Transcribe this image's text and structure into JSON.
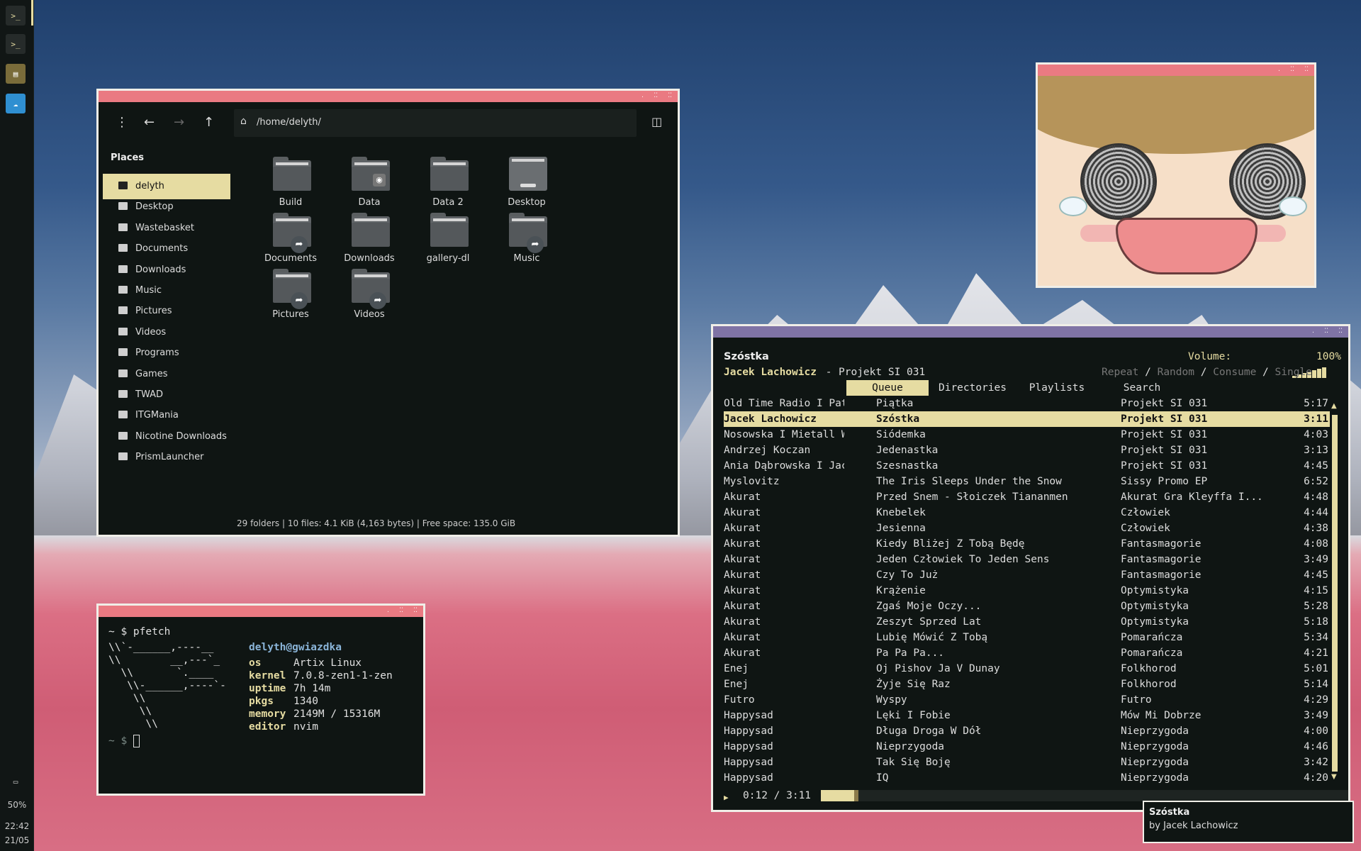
{
  "panel": {
    "launchers": [
      "terminal-icon",
      "terminal-icon",
      "file-manager-icon",
      "image-viewer-icon"
    ],
    "volume": "50%",
    "time": "22:42",
    "date": "21/05"
  },
  "file_manager": {
    "path": "/home/delyth/",
    "places_title": "Places",
    "places": [
      "delyth",
      "Desktop",
      "Wastebasket",
      "Documents",
      "Downloads",
      "Music",
      "Pictures",
      "Videos",
      "Programs",
      "Games",
      "TWAD",
      "ITGMania",
      "Nicotine Downloads",
      "PrismLauncher"
    ],
    "selected_place": "delyth",
    "items": [
      {
        "name": "Build",
        "badge": ""
      },
      {
        "name": "Data",
        "badge": "disk"
      },
      {
        "name": "Data 2",
        "badge": ""
      },
      {
        "name": "Desktop",
        "badge": "desktop"
      },
      {
        "name": "Documents",
        "badge": "link"
      },
      {
        "name": "Downloads",
        "badge": ""
      },
      {
        "name": "gallery-dl",
        "badge": ""
      },
      {
        "name": "Music",
        "badge": "link"
      },
      {
        "name": "Pictures",
        "badge": "link"
      },
      {
        "name": "Videos",
        "badge": "link"
      }
    ],
    "status": "29 folders  |  10 files: 4.1 KiB (4,163 bytes)  |  Free space: 135.0 GiB"
  },
  "terminal": {
    "prompt_cmd": "~ $ pfetch",
    "logo": [
      "\\\\`-______,----__",
      "\\\\        __,---`_",
      "  \\\\       `.____",
      "   \\\\-______,----`-",
      "    \\\\",
      "     \\\\",
      "      \\\\"
    ],
    "user_host": "delyth@gwiazdka",
    "info": [
      {
        "k": "os",
        "v": "Artix Linux"
      },
      {
        "k": "kernel",
        "v": "7.0.8-zen1-1-zen"
      },
      {
        "k": "uptime",
        "v": "7h 14m"
      },
      {
        "k": "pkgs",
        "v": "1340"
      },
      {
        "k": "memory",
        "v": "2149M / 15316M"
      },
      {
        "k": "editor",
        "v": "nvim"
      }
    ],
    "prompt2": "~ $ "
  },
  "music": {
    "song": "Szóstka",
    "artist": "Jacek Lachowicz",
    "album_sep": " - ",
    "album": "Projekt SI 031",
    "volume_label": "Volume:",
    "volume_value": "100%",
    "modes": [
      "Repeat",
      "Random",
      "Consume",
      "Single"
    ],
    "tabs": [
      "Queue",
      "Directories",
      "Playlists",
      "Search"
    ],
    "active_tab": "Queue",
    "queue": [
      [
        "Old Time Radio I Pat",
        "Piątka",
        "Projekt SI 031",
        "5:17"
      ],
      [
        "Jacek Lachowicz",
        "Szóstka",
        "Projekt SI 031",
        "3:11"
      ],
      [
        "Nosowska I Mietall W...",
        "Siódemka",
        "Projekt SI 031",
        "4:03"
      ],
      [
        "Andrzej Koczan",
        "Jedenastka",
        "Projekt SI 031",
        "3:13"
      ],
      [
        "Ania Dąbrowska I Jac...",
        "Szesnastka",
        "Projekt SI 031",
        "4:45"
      ],
      [
        "Myslovitz",
        "The Iris Sleeps Under the Snow",
        "Sissy Promo EP",
        "6:52"
      ],
      [
        "Akurat",
        "Przed Snem - Słoiczek Tiananmen",
        "Akurat Gra Kleyffa I...",
        "4:48"
      ],
      [
        "Akurat",
        "Knebelek",
        "Człowiek",
        "4:44"
      ],
      [
        "Akurat",
        "Jesienna",
        "Człowiek",
        "4:38"
      ],
      [
        "Akurat",
        "Kiedy Bliżej Z Tobą Będę",
        "Fantasmagorie",
        "4:08"
      ],
      [
        "Akurat",
        "Jeden Człowiek To Jeden Sens",
        "Fantasmagorie",
        "3:49"
      ],
      [
        "Akurat",
        "Czy To Już",
        "Fantasmagorie",
        "4:45"
      ],
      [
        "Akurat",
        "Krążenie",
        "Optymistyka",
        "4:15"
      ],
      [
        "Akurat",
        "Zgaś Moje Oczy...",
        "Optymistyka",
        "5:28"
      ],
      [
        "Akurat",
        "Zeszyt Sprzed Lat",
        "Optymistyka",
        "5:18"
      ],
      [
        "Akurat",
        "Lubię Mówić Z Tobą",
        "Pomarańcza",
        "5:34"
      ],
      [
        "Akurat",
        "Pa Pa Pa...",
        "Pomarańcza",
        "4:21"
      ],
      [
        "Enej",
        "Oj Pishov Ja V Dunay",
        "Folkhorod",
        "5:01"
      ],
      [
        "Enej",
        "Żyje Się Raz",
        "Folkhorod",
        "5:14"
      ],
      [
        "Futro",
        "Wyspy",
        "Futro",
        "4:29"
      ],
      [
        "Happysad",
        "Lęki I Fobie",
        "Mów Mi Dobrze",
        "3:49"
      ],
      [
        "Happysad",
        "Długa Droga W Dół",
        "Nieprzygoda",
        "4:00"
      ],
      [
        "Happysad",
        "Nieprzygoda",
        "Nieprzygoda",
        "4:46"
      ],
      [
        "Happysad",
        "Tak Się Boję",
        "Nieprzygoda",
        "3:42"
      ],
      [
        "Happysad",
        "IQ",
        "Nieprzygoda",
        "4:20"
      ]
    ],
    "playing_index": 1,
    "play_icon": "▶",
    "elapsed": "0:12 / 3:11",
    "progress": 0.063
  },
  "notification": {
    "title": "Szóstka",
    "body": "by Jacek Lachowicz"
  },
  "colors": {
    "accent": "#e6dca2",
    "titlebar": "#ea7a82",
    "mpd_titlebar": "#7f73a5"
  }
}
